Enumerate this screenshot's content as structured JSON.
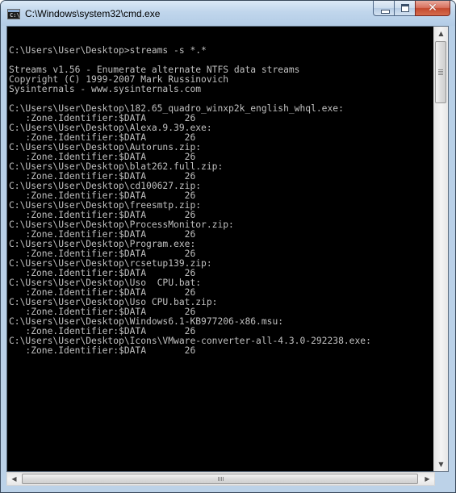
{
  "window": {
    "title": "C:\\Windows\\system32\\cmd.exe",
    "icon": "cmd-console-icon",
    "icon_text": "C:\\",
    "buttons": {
      "minimize": "minimize-icon",
      "maximize": "maximize-icon",
      "close": "close-icon"
    }
  },
  "console": {
    "lines": [
      "",
      "C:\\Users\\User\\Desktop>streams -s *.*",
      "",
      "Streams v1.56 - Enumerate alternate NTFS data streams",
      "Copyright (C) 1999-2007 Mark Russinovich",
      "Sysinternals - www.sysinternals.com",
      "",
      "C:\\Users\\User\\Desktop\\182.65_quadro_winxp2k_english_whql.exe:",
      "   :Zone.Identifier:$DATA       26",
      "C:\\Users\\User\\Desktop\\Alexa.9.39.exe:",
      "   :Zone.Identifier:$DATA       26",
      "C:\\Users\\User\\Desktop\\Autoruns.zip:",
      "   :Zone.Identifier:$DATA       26",
      "C:\\Users\\User\\Desktop\\blat262.full.zip:",
      "   :Zone.Identifier:$DATA       26",
      "C:\\Users\\User\\Desktop\\cd100627.zip:",
      "   :Zone.Identifier:$DATA       26",
      "C:\\Users\\User\\Desktop\\freesmtp.zip:",
      "   :Zone.Identifier:$DATA       26",
      "C:\\Users\\User\\Desktop\\ProcessMonitor.zip:",
      "   :Zone.Identifier:$DATA       26",
      "C:\\Users\\User\\Desktop\\Program.exe:",
      "   :Zone.Identifier:$DATA       26",
      "C:\\Users\\User\\Desktop\\rcsetup139.zip:",
      "   :Zone.Identifier:$DATA       26",
      "C:\\Users\\User\\Desktop\\Uso  CPU.bat:",
      "   :Zone.Identifier:$DATA       26",
      "C:\\Users\\User\\Desktop\\Uso CPU.bat.zip:",
      "   :Zone.Identifier:$DATA       26",
      "C:\\Users\\User\\Desktop\\Windows6.1-KB977206-x86.msu:",
      "   :Zone.Identifier:$DATA       26",
      "C:\\Users\\User\\Desktop\\Icons\\VMware-converter-all-4.3.0-292238.exe:",
      "   :Zone.Identifier:$DATA       26"
    ]
  },
  "scrollbars": {
    "vertical": {
      "up": "▲",
      "down": "▼"
    },
    "horizontal": {
      "left": "◀",
      "right": "▶"
    }
  },
  "colors": {
    "console_background": "#000000",
    "console_text": "#c0c0c0",
    "title_bar": "#c0d6ec",
    "close_button": "#c44a2f"
  }
}
